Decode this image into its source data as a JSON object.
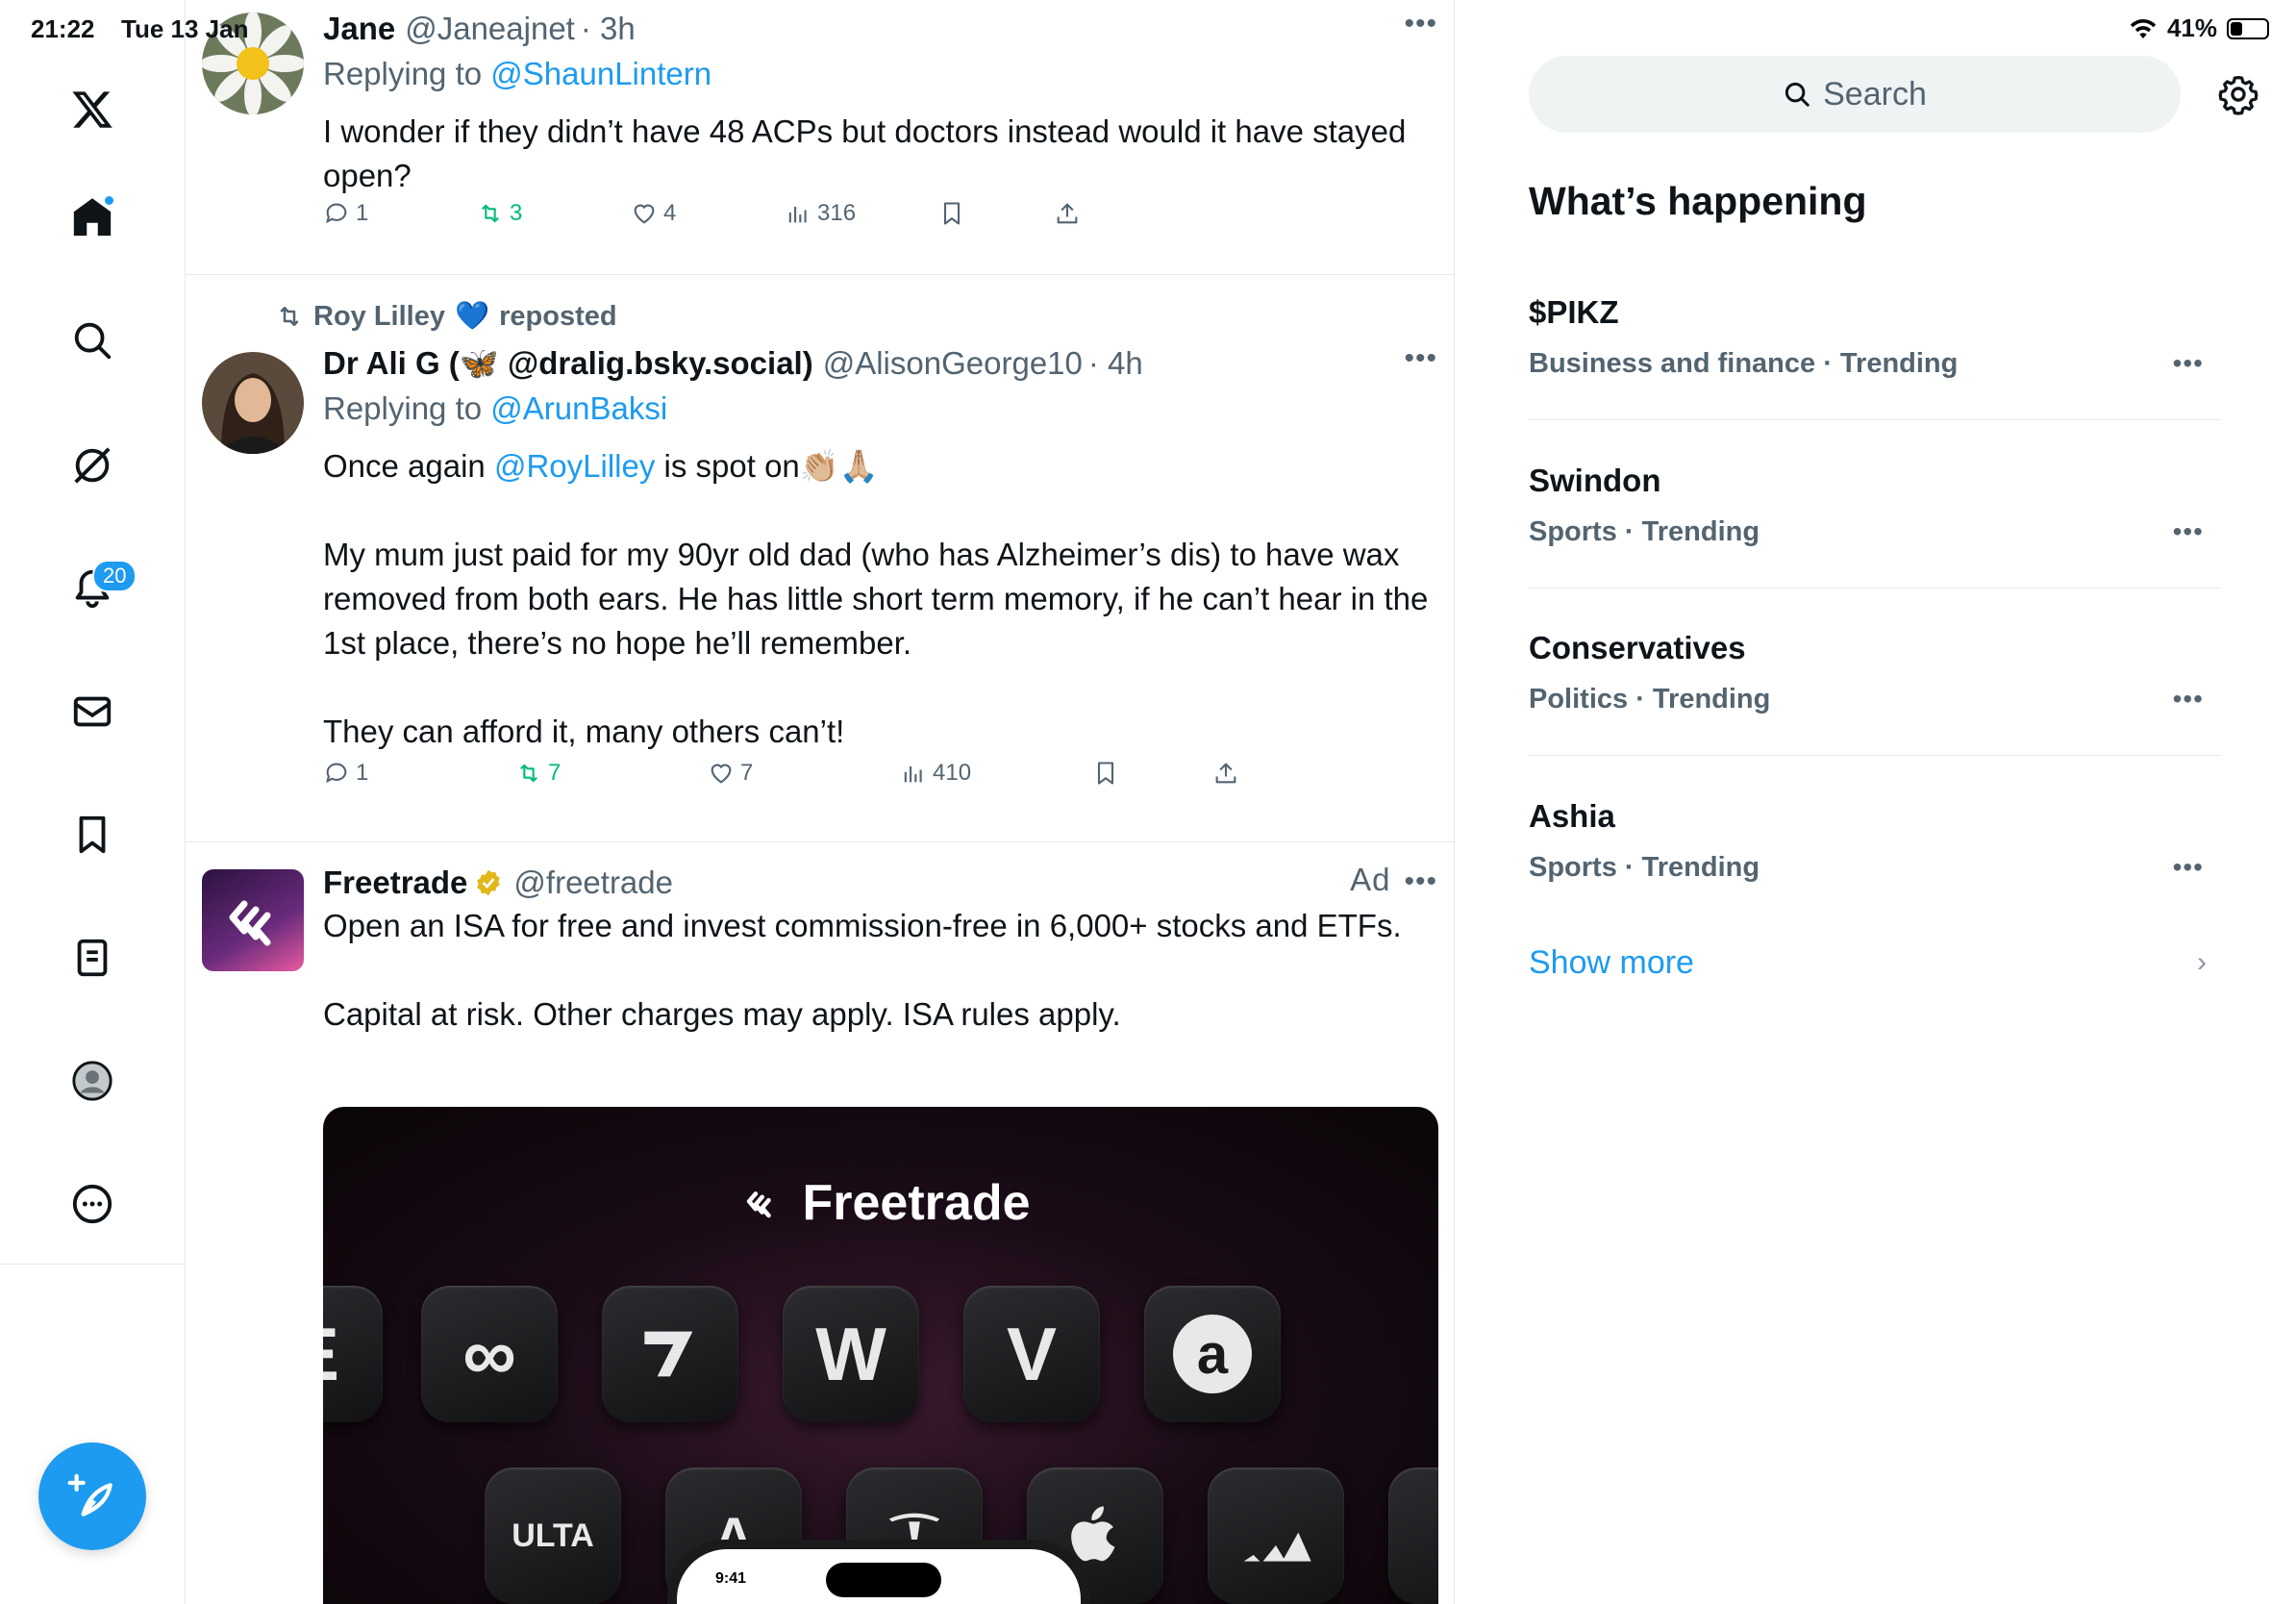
{
  "status": {
    "time": "21:22",
    "date": "Tue 13 Jan",
    "battery": "41%",
    "battery_level": 0.41
  },
  "nav": {
    "notifications_count": "20"
  },
  "tweets": [
    {
      "name": "Jane",
      "handle": "@Janeajnet",
      "time": "· 3h",
      "reply_prefix": "Replying to",
      "reply_to": "@ShaunLintern",
      "text": "I wonder if they didn’t have 48 ACPs but doctors instead would it have stayed open?",
      "replies": "1",
      "reposts": "3",
      "likes": "4",
      "views": "316"
    },
    {
      "reposted_by": "Roy Lilley",
      "reposted_label": "reposted",
      "name": "Dr Ali G (",
      "name_suffix": " @dralig.bsky.social)",
      "handle": "@AlisonGeorge10",
      "time": "· 4h",
      "reply_prefix": "Replying to",
      "reply_to": "@ArunBaksi",
      "text_prefix": "Once again",
      "text_mention": "@RoyLilley",
      "text_suffix": "is spot on",
      "text_emoji": "👏🏼🙏🏼",
      "para2": "My mum just paid for my 90yr old dad (who has Alzheimer’s dis) to have wax removed from both ears. He has little short term memory, if he can’t hear in the 1st place, there’s no hope he’ll remember.",
      "para3": "They can afford it, many others can’t!",
      "replies": "1",
      "reposts": "7",
      "likes": "7",
      "views": "410"
    },
    {
      "name": "Freetrade",
      "handle": "@freetrade",
      "ad_label": "Ad",
      "text": "Open an ISA for free and invest commission-free in 6,000+ stocks and ETFs.",
      "para2": "Capital at risk. Other charges may apply. ISA rules apply.",
      "media_logo": "Freetrade",
      "media_keys": [
        "E",
        "∞",
        "",
        "W",
        "V",
        "a",
        "ULTA",
        "A",
        "",
        "",
        ""
      ],
      "phone_time": "9:41"
    }
  ],
  "search": {
    "placeholder": "Search"
  },
  "sidebar": {
    "title": "What’s happening",
    "trends": [
      {
        "name": "$PIKZ",
        "meta": "Business and finance · Trending"
      },
      {
        "name": "Swindon",
        "meta": "Sports · Trending"
      },
      {
        "name": "Conservatives",
        "meta": "Politics · Trending"
      },
      {
        "name": "Ashia",
        "meta": "Sports · Trending"
      }
    ],
    "show_more": "Show more"
  },
  "colors": {
    "accent": "#1d9bf0",
    "repost_green": "#00ba7c",
    "muted": "#536471"
  }
}
